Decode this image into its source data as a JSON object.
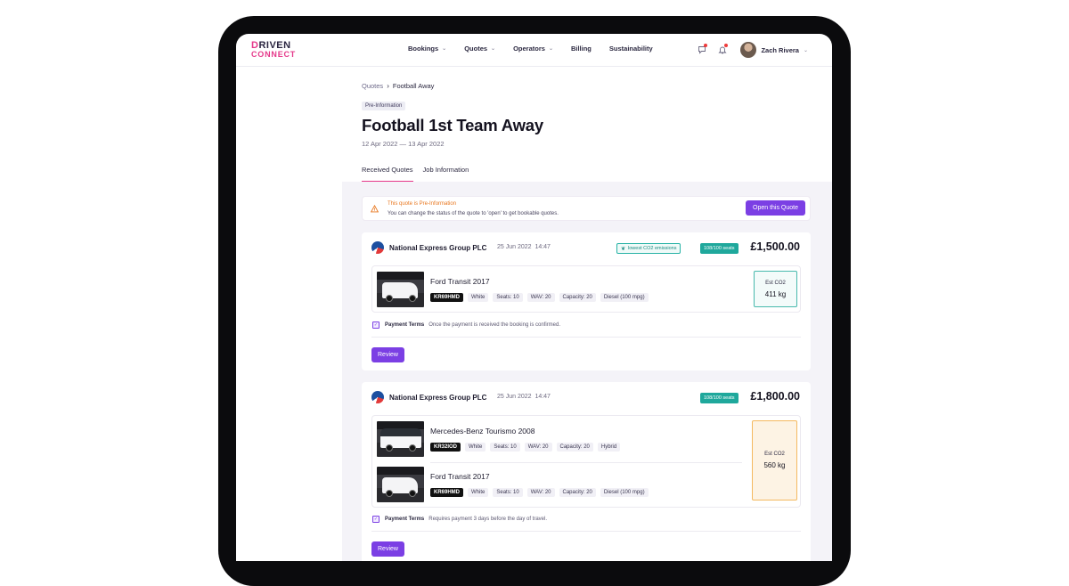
{
  "brand": {
    "line1a": "D",
    "line1b": "RIVEN",
    "line2": "CONNECT"
  },
  "nav": {
    "links": [
      {
        "label": "Bookings",
        "chevron": true
      },
      {
        "label": "Quotes",
        "chevron": true
      },
      {
        "label": "Operators",
        "chevron": true
      },
      {
        "label": "Billing",
        "chevron": false
      },
      {
        "label": "Sustainability",
        "chevron": false
      }
    ],
    "user": "Zach Rivera"
  },
  "breadcrumb": {
    "parent": "Quotes",
    "current": "Football Away"
  },
  "badge": "Pre-Information",
  "title": "Football 1st Team Away",
  "dates": "12 Apr 2022 — 13 Apr 2022",
  "tabs": [
    "Received Quotes",
    "Job Information"
  ],
  "banner": {
    "heading": "This quote is Pre-Information",
    "text": "You can change the status of the quote to 'open' to get bookable quotes.",
    "button": "Open this Quote"
  },
  "quotes": [
    {
      "operator": "National Express Group PLC",
      "date": "25 Jun 2022",
      "time": "14:47",
      "co2_tag": "lowest CO2 emissions",
      "seats": "108/100 seats",
      "price": "£1,500.00",
      "vehicles": [
        {
          "name": "Ford Transit 2017",
          "plate": "KR69HMD",
          "tags": [
            "White",
            "Seats: 10",
            "WAV: 20",
            "Capacity: 20",
            "Diesel (100 mpg)"
          ]
        }
      ],
      "est_label": "Est CO2",
      "est_value": "411 kg",
      "payment_label": "Payment Terms",
      "payment_text": "Once the payment is received the booking is confirmed.",
      "review": "Review"
    },
    {
      "operator": "National Express Group PLC",
      "date": "25 Jun 2022",
      "time": "14:47",
      "seats": "108/100 seats",
      "price": "£1,800.00",
      "vehicles": [
        {
          "name": "Mercedes-Benz Tourismo 2008",
          "plate": "KR32IOD",
          "tags": [
            "White",
            "Seats: 10",
            "WAV: 20",
            "Capacity: 20",
            "Hybrid"
          ]
        },
        {
          "name": "Ford Transit 2017",
          "plate": "KR69HMD",
          "tags": [
            "White",
            "Seats: 10",
            "WAV: 20",
            "Capacity: 20",
            "Diesel (100 mpg)"
          ]
        }
      ],
      "est_label": "Est CO2",
      "est_value": "560 kg",
      "payment_label": "Payment Terms",
      "payment_text": "Requires payment 3 days before the day of travel.",
      "review": "Review"
    }
  ],
  "colors": {
    "accent": "#7b3fe4",
    "brand_pink": "#e5388a",
    "teal": "#1fa89c",
    "warning": "#e8761d"
  }
}
